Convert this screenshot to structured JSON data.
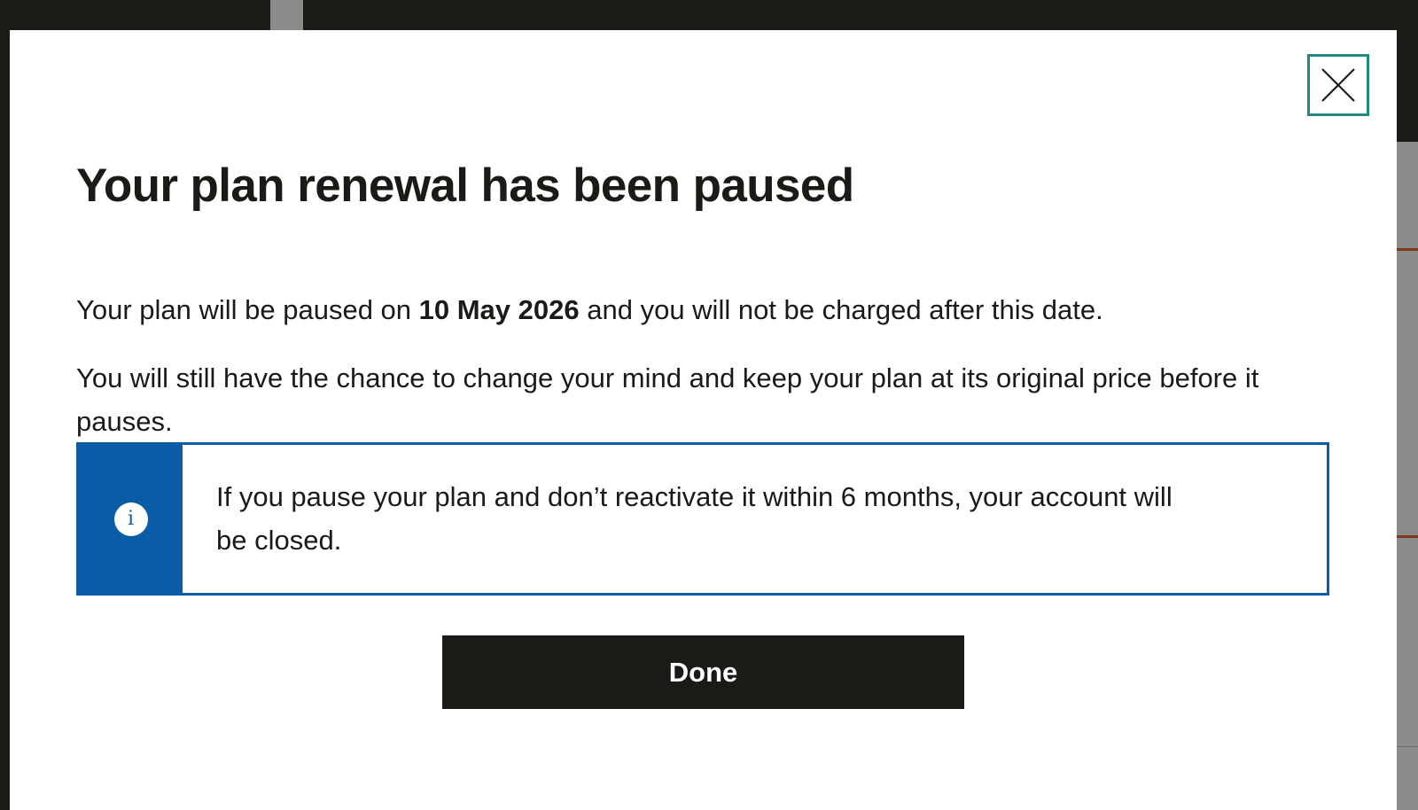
{
  "modal": {
    "title": "Your plan renewal has been paused",
    "paragraph_1": {
      "prefix": "Your plan will be paused on ",
      "date": "10 May 2026",
      "suffix": " and you will not be charged after this date."
    },
    "paragraph_2": "You will still have the chance to change your mind and keep your plan at its original price before it pauses.",
    "info": {
      "icon": "info-icon",
      "icon_glyph": "i",
      "text": "If you pause your plan and don’t reactivate it within 6 months, your account will be closed."
    },
    "done_label": "Done",
    "close_icon": "close-icon"
  },
  "colors": {
    "primary_dark": "#1b1a17",
    "info_blue": "#0b5ca6",
    "close_border_teal": "#1e8a82",
    "overlay_gray": "#8c8c8c",
    "background_accent": "#7b3b1c"
  }
}
